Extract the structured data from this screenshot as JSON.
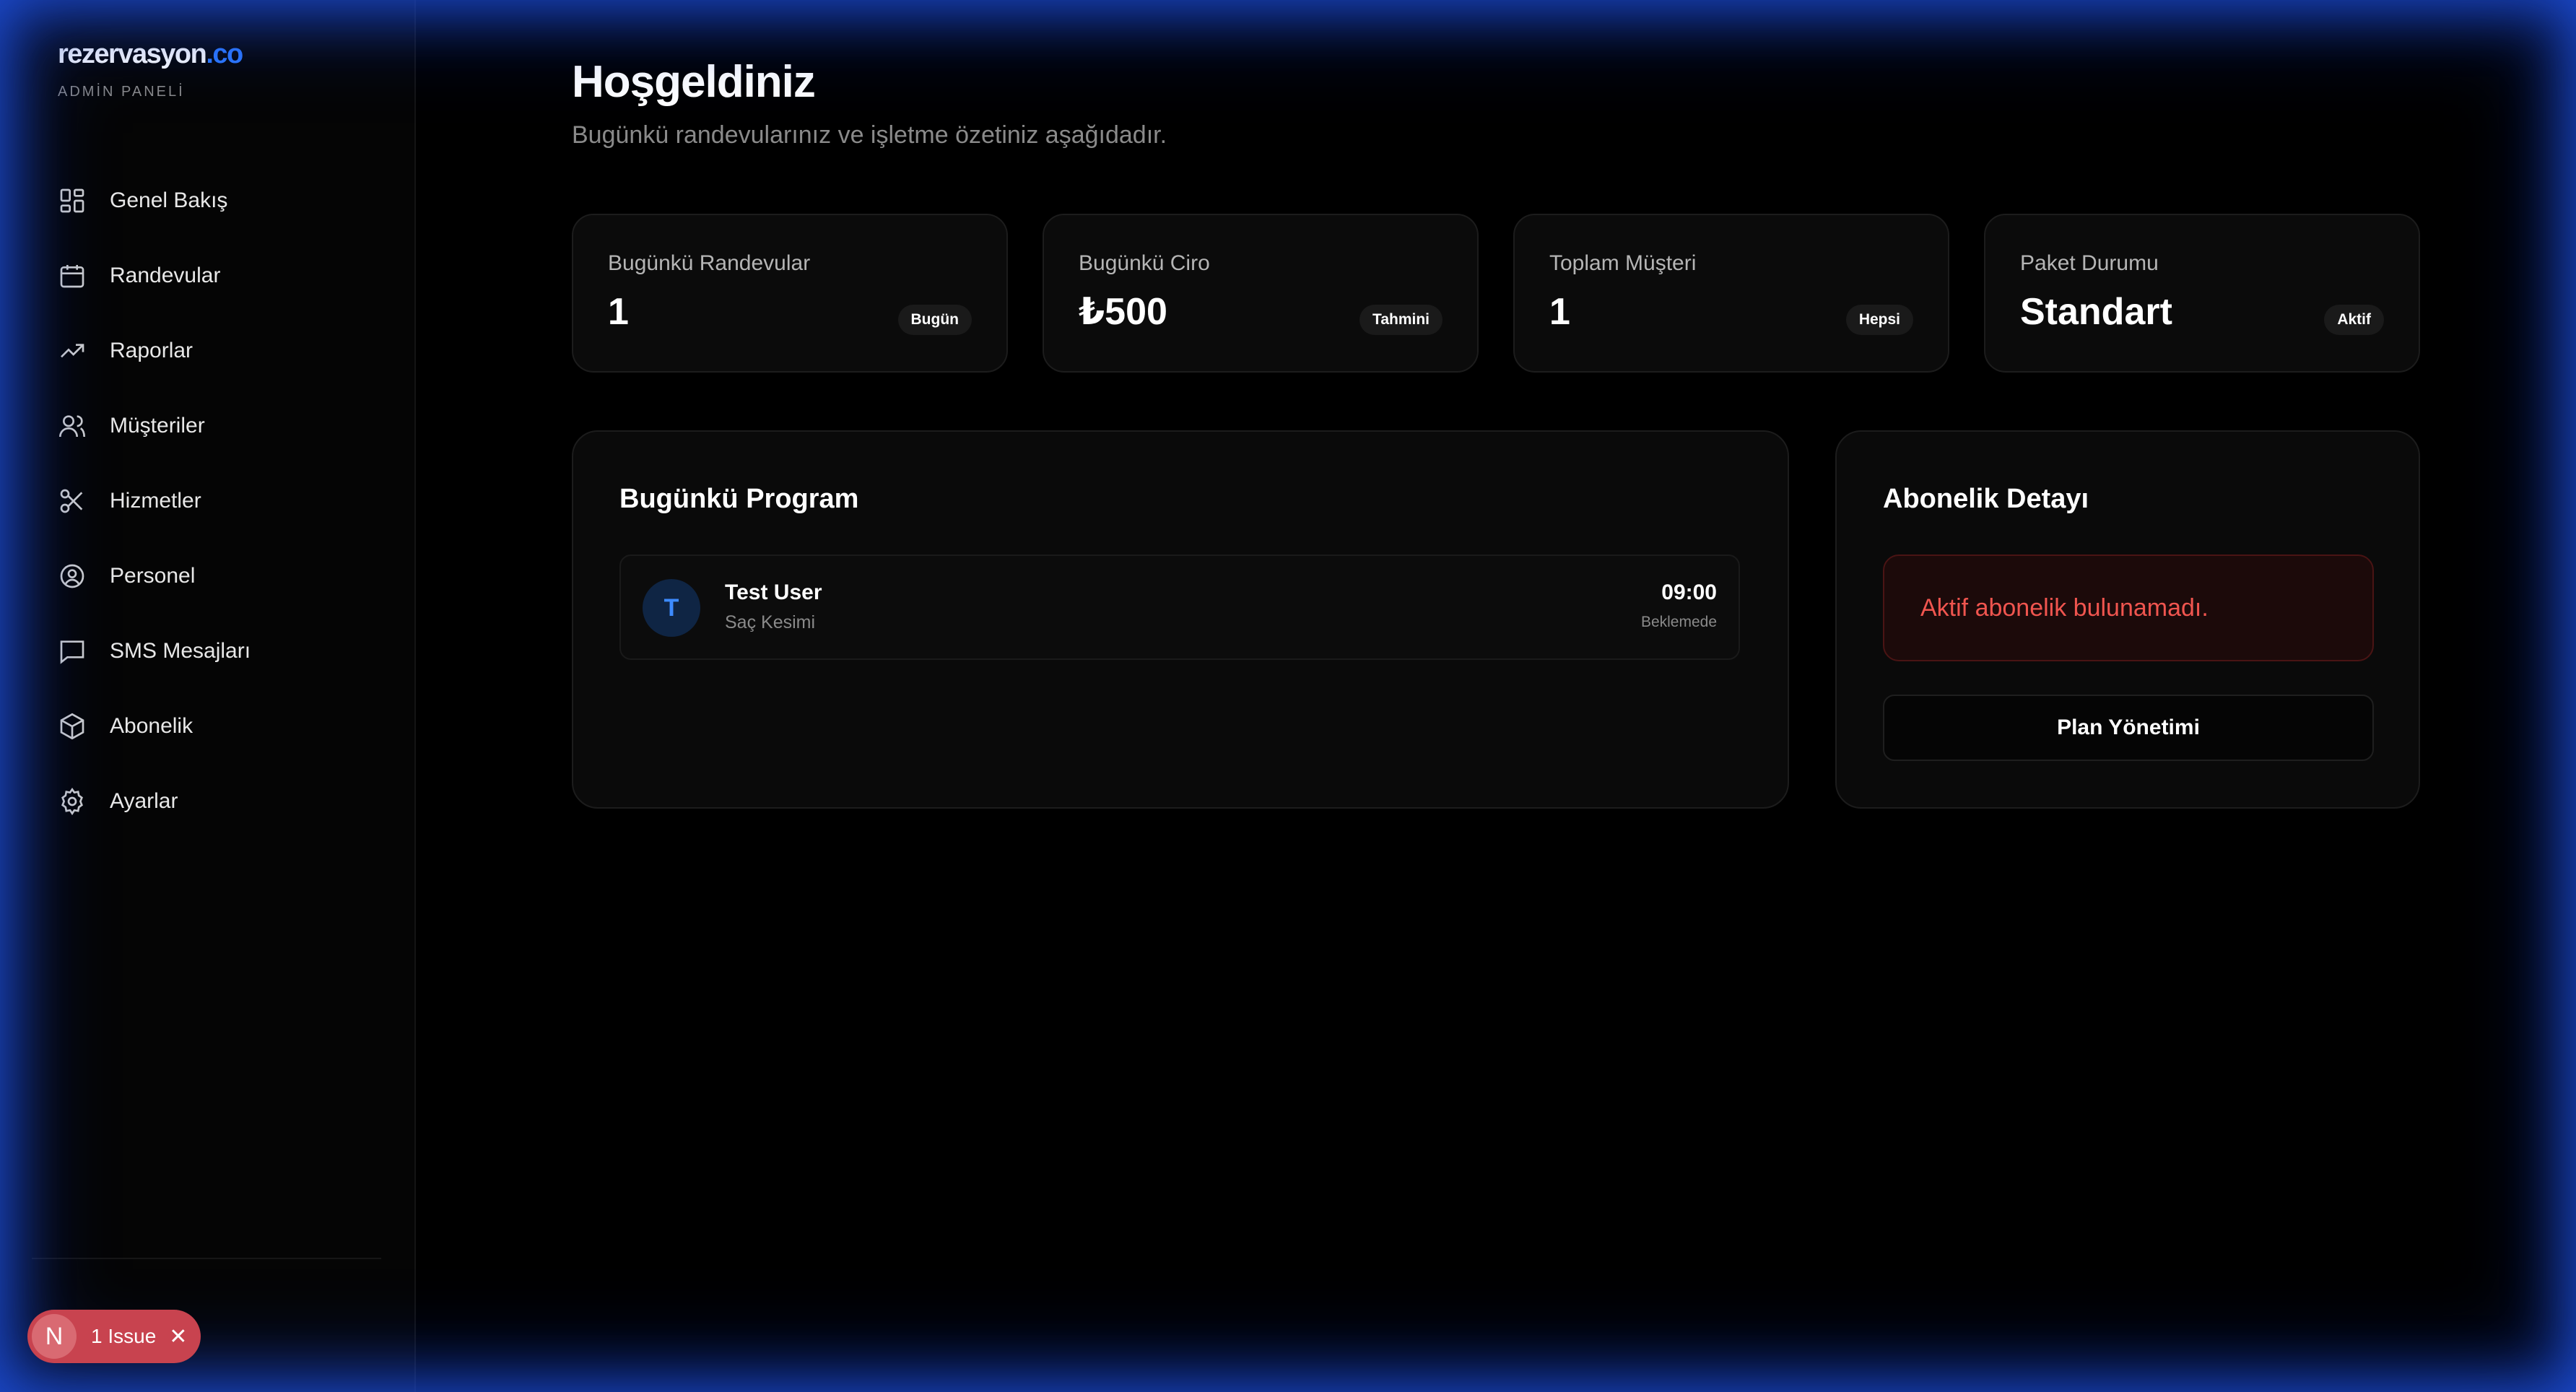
{
  "sidebar": {
    "brand_main": "rezervasyon",
    "brand_accent": ".co",
    "subtitle": "ADMİN PANELİ",
    "items": [
      {
        "label": "Genel Bakış",
        "icon": "dashboard-grid-icon"
      },
      {
        "label": "Randevular",
        "icon": "calendar-icon"
      },
      {
        "label": "Raporlar",
        "icon": "trending-up-icon"
      },
      {
        "label": "Müşteriler",
        "icon": "users-icon"
      },
      {
        "label": "Hizmetler",
        "icon": "scissors-icon"
      },
      {
        "label": "Personel",
        "icon": "user-circle-icon"
      },
      {
        "label": "SMS Mesajları",
        "icon": "message-square-icon"
      },
      {
        "label": "Abonelik",
        "icon": "package-icon"
      },
      {
        "label": "Ayarlar",
        "icon": "gear-icon"
      }
    ]
  },
  "issue_badge": {
    "letter": "N",
    "text": "1 Issue",
    "close": "✕"
  },
  "header": {
    "title": "Hoşgeldiniz",
    "subtitle": "Bugünkü randevularınız ve işletme özetiniz aşağıdadır."
  },
  "stats": [
    {
      "label": "Bugünkü Randevular",
      "value": "1",
      "badge": "Bugün"
    },
    {
      "label": "Bugünkü Ciro",
      "value": "₺500",
      "badge": "Tahmini"
    },
    {
      "label": "Toplam Müşteri",
      "value": "1",
      "badge": "Hepsi"
    },
    {
      "label": "Paket Durumu",
      "value": "Standart",
      "badge": "Aktif"
    }
  ],
  "program": {
    "title": "Bugünkü Program",
    "appointments": [
      {
        "initial": "T",
        "name": "Test User",
        "service": "Saç Kesimi",
        "time": "09:00",
        "status": "Beklemede"
      }
    ]
  },
  "subscription": {
    "title": "Abonelik Detayı",
    "alert": "Aktif abonelik bulunamadı.",
    "button": "Plan Yönetimi"
  },
  "colors": {
    "accent": "#2f7bff",
    "danger": "#f0554f",
    "issue": "#c8434f"
  }
}
